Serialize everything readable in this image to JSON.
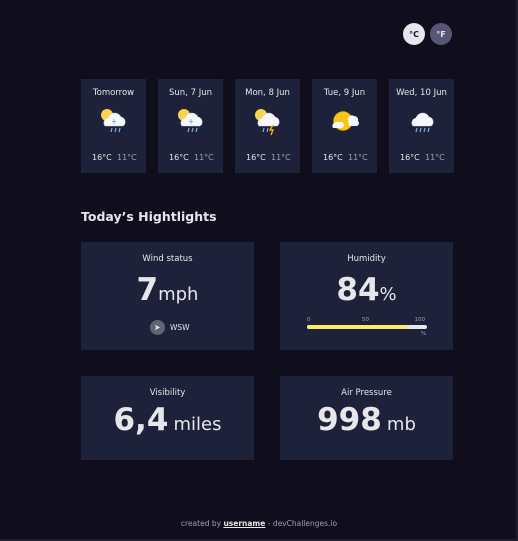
{
  "units": {
    "celsius": "°C",
    "fahrenheit": "°F"
  },
  "forecast": [
    {
      "day": "Tomorrow",
      "icon": "sleet-icon",
      "max": "16°C",
      "min": "11°C"
    },
    {
      "day": "Sun, 7 Jun",
      "icon": "sleet-icon",
      "max": "16°C",
      "min": "11°C"
    },
    {
      "day": "Mon, 8 Jun",
      "icon": "thunderstorm-icon",
      "max": "16°C",
      "min": "11°C"
    },
    {
      "day": "Tue, 9 Jun",
      "icon": "partly-cloudy-icon",
      "max": "16°C",
      "min": "11°C"
    },
    {
      "day": "Wed, 10 Jun",
      "icon": "rain-icon",
      "max": "16°C",
      "min": "11°C"
    }
  ],
  "highlights": {
    "title": "Today’s Hightlights",
    "wind": {
      "label": "Wind status",
      "value": "7",
      "unit": "mph",
      "direction": "WSW"
    },
    "humidity": {
      "label": "Humidity",
      "value": "84",
      "unit": "%",
      "percent": 84,
      "scale": [
        "0",
        "50",
        "100"
      ],
      "scale_unit": "%"
    },
    "visibility": {
      "label": "Visibility",
      "value": "6,4",
      "unit": "miles"
    },
    "pressure": {
      "label": "Air Pressure",
      "value": "998",
      "unit": "mb"
    }
  },
  "footer": {
    "prefix": "created by ",
    "username": "username",
    "suffix": " - devChallenges.io"
  },
  "colors": {
    "background": "#100e1d",
    "card": "#1e213a",
    "accent": "#ffec65"
  }
}
